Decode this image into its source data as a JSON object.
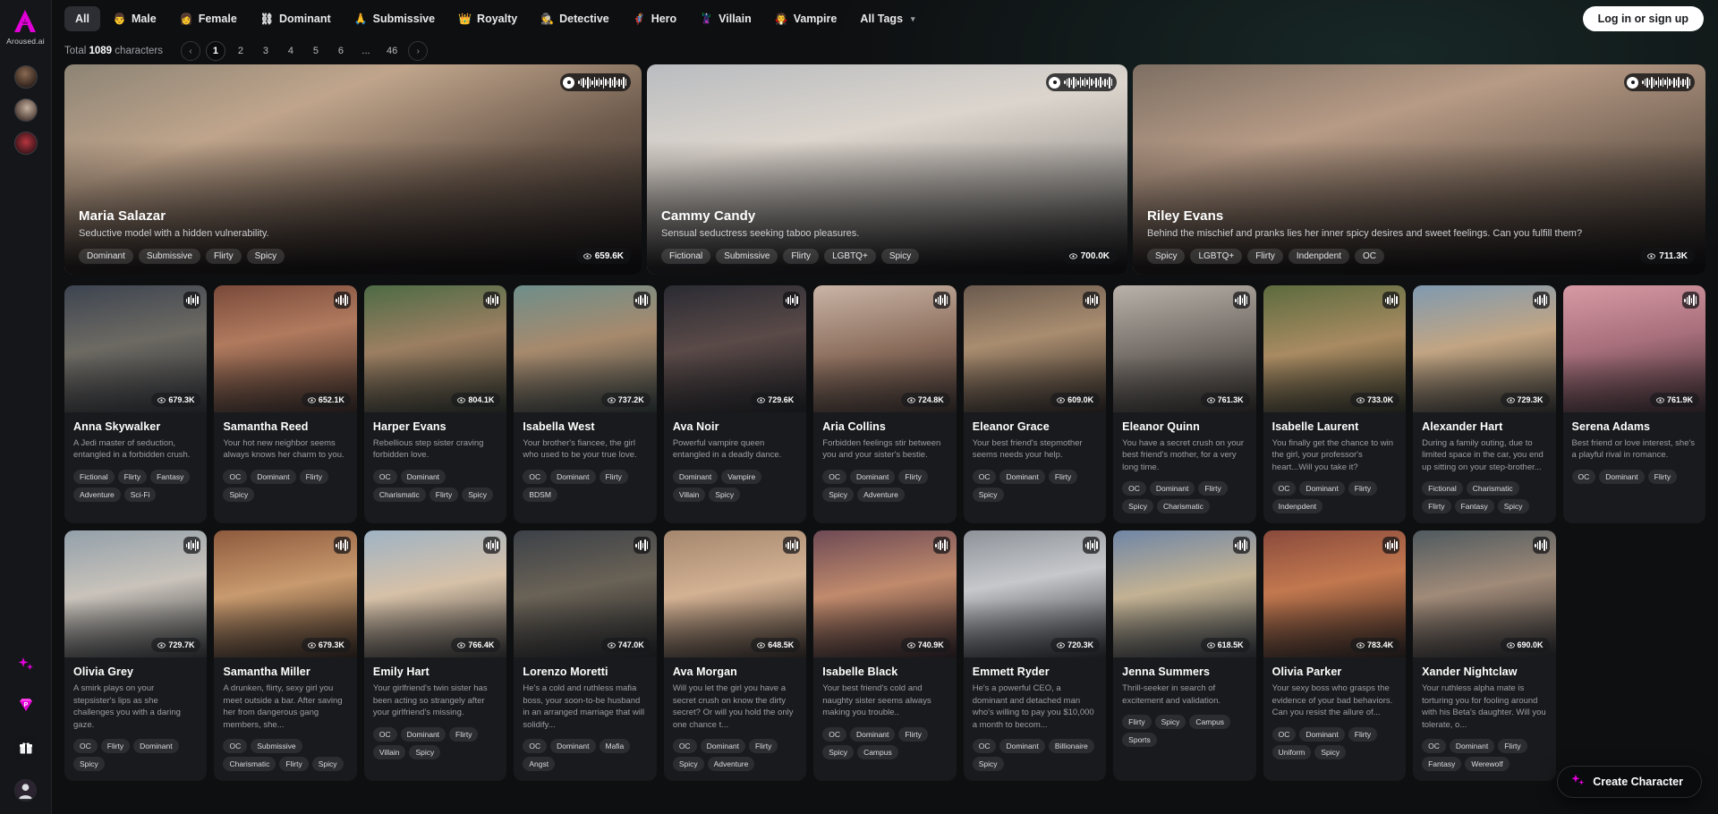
{
  "brand": {
    "name": "Aroused.ai",
    "logo_icon": "aroused-logo-icon"
  },
  "rail": {
    "recent_label": "recent-characters",
    "bottom_items": [
      {
        "name": "sparkles-icon",
        "glyph": "✦"
      },
      {
        "name": "premium-diamond-icon",
        "glyph": "P"
      },
      {
        "name": "gift-icon",
        "glyph": "🎁"
      },
      {
        "name": "user-avatar-icon",
        "glyph": ""
      }
    ]
  },
  "topnav": {
    "items": [
      {
        "label": "All",
        "emoji": "",
        "active": true
      },
      {
        "label": "Male",
        "emoji": "👨",
        "active": false
      },
      {
        "label": "Female",
        "emoji": "👩",
        "active": false
      },
      {
        "label": "Dominant",
        "emoji": "⛓",
        "active": false
      },
      {
        "label": "Submissive",
        "emoji": "🙏",
        "active": false
      },
      {
        "label": "Royalty",
        "emoji": "👑",
        "active": false
      },
      {
        "label": "Detective",
        "emoji": "🕵️",
        "active": false
      },
      {
        "label": "Hero",
        "emoji": "🦸",
        "active": false
      },
      {
        "label": "Villain",
        "emoji": "🦹",
        "active": false
      },
      {
        "label": "Vampire",
        "emoji": "🧛",
        "active": false
      }
    ],
    "all_tags_label": "All Tags",
    "chevron_icon": "chevron-down-icon",
    "login_label": "Log in or sign up"
  },
  "pagination": {
    "total_prefix": "Total",
    "total_count": "1089",
    "total_suffix": "characters",
    "prev_icon": "chevron-left-icon",
    "next_icon": "chevron-right-icon",
    "pages": [
      "1",
      "2",
      "3",
      "4",
      "5",
      "6",
      "...",
      "46"
    ],
    "current": "1"
  },
  "heroes": [
    {
      "name": "Maria Salazar",
      "desc": "Seductive model with a hidden vulnerability.",
      "tags": [
        "Dominant",
        "Submissive",
        "Flirty",
        "Spicy"
      ],
      "views": "659.6K",
      "voice_icon": "voice-waveform-icon",
      "art": "hero-maria"
    },
    {
      "name": "Cammy Candy",
      "desc": "Sensual seductress seeking taboo pleasures.",
      "tags": [
        "Fictional",
        "Submissive",
        "Flirty",
        "LGBTQ+",
        "Spicy"
      ],
      "views": "700.0K",
      "voice_icon": "voice-waveform-icon",
      "art": "hero-cammy"
    },
    {
      "name": "Riley Evans",
      "desc": "Behind the mischief and pranks lies her inner spicy desires and sweet feelings. Can you fulfill them?",
      "tags": [
        "Spicy",
        "LGBTQ+",
        "Flirty",
        "Indenpdent",
        "OC"
      ],
      "views": "711.3K",
      "voice_icon": "voice-waveform-icon",
      "art": "hero-riley"
    }
  ],
  "cards": [
    {
      "name": "Anna Skywalker",
      "desc": "A Jedi master of seduction, entangled in a forbidden crush.",
      "tags": [
        "Fictional",
        "Flirty",
        "Fantasy",
        "Adventure",
        "Sci-Fi"
      ],
      "views": "679.3K",
      "art": "c1"
    },
    {
      "name": "Samantha Reed",
      "desc": "Your hot new neighbor seems always knows her charm to you.",
      "tags": [
        "OC",
        "Dominant",
        "Flirty",
        "Spicy"
      ],
      "views": "652.1K",
      "art": "c2"
    },
    {
      "name": "Harper Evans",
      "desc": "Rebellious step sister craving forbidden love.",
      "tags": [
        "OC",
        "Dominant",
        "Charismatic",
        "Flirty",
        "Spicy"
      ],
      "views": "804.1K",
      "art": "c3"
    },
    {
      "name": "Isabella West",
      "desc": "Your brother's fiancee, the girl who used to be your true love.",
      "tags": [
        "OC",
        "Dominant",
        "Flirty",
        "BDSM"
      ],
      "views": "737.2K",
      "art": "c4"
    },
    {
      "name": "Ava Noir",
      "desc": "Powerful vampire queen entangled in a deadly dance.",
      "tags": [
        "Dominant",
        "Vampire",
        "Villain",
        "Spicy"
      ],
      "views": "729.6K",
      "art": "c5"
    },
    {
      "name": "Aria Collins",
      "desc": "Forbidden feelings stir between you and your sister's bestie.",
      "tags": [
        "OC",
        "Dominant",
        "Flirty",
        "Spicy",
        "Adventure"
      ],
      "views": "724.8K",
      "art": "c6"
    },
    {
      "name": "Eleanor Grace",
      "desc": "Your best friend's stepmother seems needs your help.",
      "tags": [
        "OC",
        "Dominant",
        "Flirty",
        "Spicy"
      ],
      "views": "609.0K",
      "art": "c7"
    },
    {
      "name": "Eleanor Quinn",
      "desc": "You have a secret crush on your best friend's mother, for a very long time.",
      "tags": [
        "OC",
        "Dominant",
        "Flirty",
        "Spicy",
        "Charismatic"
      ],
      "views": "761.3K",
      "art": "c8"
    },
    {
      "name": "Isabelle Laurent",
      "desc": "You finally get the chance to win the girl, your professor's heart...Will you take it?",
      "tags": [
        "OC",
        "Dominant",
        "Flirty",
        "Indenpdent"
      ],
      "views": "733.0K",
      "art": "c9"
    },
    {
      "name": "Alexander Hart",
      "desc": "During a family outing, due to limited space in the car, you end up sitting on your step-brother...",
      "tags": [
        "Fictional",
        "Charismatic",
        "Flirty",
        "Fantasy",
        "Spicy"
      ],
      "views": "729.3K",
      "art": "c10"
    },
    {
      "name": "Serena Adams",
      "desc": "Best friend or love interest, she's a playful rival in romance.",
      "tags": [
        "OC",
        "Dominant",
        "Flirty"
      ],
      "views": "761.9K",
      "art": "c11"
    },
    {
      "name": "Olivia Grey",
      "desc": "A smirk plays on your stepsister's lips as she challenges you with a daring gaze.",
      "tags": [
        "OC",
        "Flirty",
        "Dominant",
        "Spicy"
      ],
      "views": "729.7K",
      "art": "c12"
    },
    {
      "name": "Samantha Miller",
      "desc": "A drunken, flirty, sexy girl you meet outside a bar. After saving her from dangerous gang members, she...",
      "tags": [
        "OC",
        "Submissive",
        "Charismatic",
        "Flirty",
        "Spicy"
      ],
      "views": "679.3K",
      "art": "c13"
    },
    {
      "name": "Emily Hart",
      "desc": "Your girlfriend's twin sister has been acting so strangely after your girlfriend's missing.",
      "tags": [
        "OC",
        "Dominant",
        "Flirty",
        "Villain",
        "Spicy"
      ],
      "views": "766.4K",
      "art": "c14"
    },
    {
      "name": "Lorenzo Moretti",
      "desc": "He's a cold and ruthless mafia boss, your soon-to-be husband in an arranged marriage that will solidify...",
      "tags": [
        "OC",
        "Dominant",
        "Mafia",
        "Angst"
      ],
      "views": "747.0K",
      "art": "c15"
    },
    {
      "name": "Ava Morgan",
      "desc": "Will you let the girl you have a secret crush on know the dirty secret? Or will you hold the only one chance t...",
      "tags": [
        "OC",
        "Dominant",
        "Flirty",
        "Spicy",
        "Adventure"
      ],
      "views": "648.5K",
      "art": "c16"
    },
    {
      "name": "Isabelle Black",
      "desc": "Your best friend's cold and naughty sister seems always making you trouble..",
      "tags": [
        "OC",
        "Dominant",
        "Flirty",
        "Spicy",
        "Campus"
      ],
      "views": "740.9K",
      "art": "c17"
    },
    {
      "name": "Emmett Ryder",
      "desc": "He's a powerful CEO, a dominant and detached man who's willing to pay you $10,000 a month to becom...",
      "tags": [
        "OC",
        "Dominant",
        "Billionaire",
        "Spicy"
      ],
      "views": "720.3K",
      "art": "c18"
    },
    {
      "name": "Jenna Summers",
      "desc": "Thrill-seeker in search of excitement and validation.",
      "tags": [
        "Flirty",
        "Spicy",
        "Campus",
        "Sports"
      ],
      "views": "618.5K",
      "art": "c19"
    },
    {
      "name": "Olivia Parker",
      "desc": "Your sexy boss who grasps the evidence of your bad behaviors. Can you resist the allure of...",
      "tags": [
        "OC",
        "Dominant",
        "Flirty",
        "Uniform",
        "Spicy"
      ],
      "views": "783.4K",
      "art": "c20"
    },
    {
      "name": "Xander Nightclaw",
      "desc": "Your ruthless alpha mate is torturing you for fooling around with his Beta's daughter. Will you tolerate, o...",
      "tags": [
        "OC",
        "Dominant",
        "Flirty",
        "Fantasy",
        "Werewolf"
      ],
      "views": "690.0K",
      "art": "c21"
    }
  ],
  "fab": {
    "label": "Create Character",
    "icon": "sparkles-icon"
  },
  "colors": {
    "accent": "#e100d8",
    "surface": "#191a1d",
    "background": "#0e0f11",
    "text": "#ffffff"
  }
}
